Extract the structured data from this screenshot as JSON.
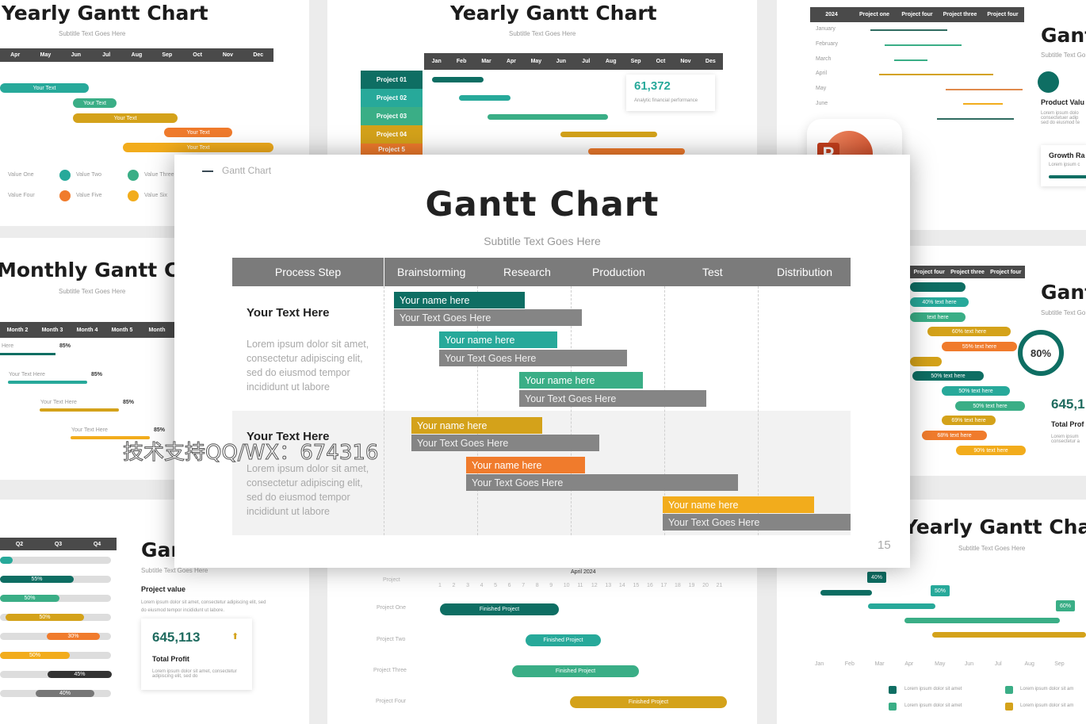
{
  "bg_top_left": {
    "title": "Yearly Gantt Chart",
    "subtitle": "Subtitle Text Goes Here",
    "months": [
      "Apr",
      "May",
      "Jun",
      "Jul",
      "Aug",
      "Sep",
      "Oct",
      "Nov",
      "Dec"
    ],
    "bars": [
      "Your Text",
      "Your Text",
      "Your Text",
      "Your Text",
      "Your Text"
    ],
    "legend": [
      "Value One",
      "Value Two",
      "Value Three",
      "Value Four",
      "Value Five",
      "Value Six"
    ]
  },
  "bg_top_center": {
    "title": "Yearly Gantt Chart",
    "subtitle": "Subtitle Text Goes Here",
    "months": [
      "Jan",
      "Feb",
      "Mar",
      "Apr",
      "May",
      "Jun",
      "Jul",
      "Aug",
      "Sep",
      "Oct",
      "Nov",
      "Des"
    ],
    "projects": [
      "Project 01",
      "Project 02",
      "Project 03",
      "Project 04",
      "Project 5"
    ],
    "stat_value": "61,372",
    "stat_label": "Analytic financial performance"
  },
  "bg_top_right": {
    "headers": [
      "2024",
      "Project one",
      "Project four",
      "Project three",
      "Project four"
    ],
    "months": [
      "January",
      "February",
      "March",
      "April",
      "May",
      "June"
    ],
    "title": "Gant",
    "subtitle": "Subtitle Text Go",
    "product_value": "Product Valu",
    "product_text": "Lorem ipsum dolo consectetuer adip sed do eiusmod te",
    "growth": "Growth Ra",
    "growth_text": "Lorem ipsum c"
  },
  "bg_mid_left": {
    "title": "Monthly Gantt Cha",
    "subtitle": "Subtitle Text Goes Here",
    "months": [
      "Month 2",
      "Month 3",
      "Month 4",
      "Month 5",
      "Month"
    ],
    "rows": [
      {
        "label": "Here",
        "pct": "85%"
      },
      {
        "label": "Your Text Here",
        "pct": "85%"
      },
      {
        "label": "Your Text Here",
        "pct": "85%"
      },
      {
        "label": "Your Text Here",
        "pct": "85%"
      }
    ]
  },
  "bg_mid_right": {
    "headers": [
      "Project four",
      "Project three",
      "Project four"
    ],
    "bars": [
      "40%  text here",
      "text here",
      "60%  text here",
      "55%  text here",
      "50%  text here",
      "50%  text here",
      "50%  text here",
      "69%  text here",
      "68%  text here",
      "90%  text here"
    ],
    "title": "Gant",
    "subtitle": "Subtitle Text Go",
    "ring_value": "80%",
    "ring_fraction": 0.8,
    "stat": "645,1",
    "stat_label": "Total Prof",
    "stat_text": "Lorem ipsum consectetur a"
  },
  "bg_bottom_left": {
    "quarters": [
      "Q2",
      "Q3",
      "Q4"
    ],
    "bars": [
      "",
      "55%",
      "50%",
      "50%",
      "30%",
      "50%",
      "45%",
      "40%"
    ],
    "title": "Gar",
    "subtitle": "Subtitle Text Goes Here",
    "section": "Project value",
    "section_text": "Lorem ipsum dolor sit amet, consectetur adipiscing elit, sed do eiusmod tempor incididunt ut labore.",
    "stat": "645,113",
    "stat_label": "Total Profit",
    "stat_text": "Lorem ipsum dolor sit amet, consectetur adipiscing elit, sed do"
  },
  "bg_bottom_center": {
    "month": "April 2024",
    "project_header": "Project",
    "days": [
      "1",
      "2",
      "3",
      "4",
      "5",
      "6",
      "7",
      "8",
      "9",
      "10",
      "11",
      "12",
      "13",
      "14",
      "15",
      "16",
      "17",
      "18",
      "19",
      "20",
      "21"
    ],
    "projects": [
      "Project One",
      "Project Two",
      "Project Three",
      "Project Four"
    ],
    "bar_label": "Finished Project"
  },
  "bg_bottom_right": {
    "title": "Yearly Gantt Chart",
    "subtitle": "Subtitle Text Goes Here",
    "callouts": [
      "40%",
      "50%",
      "60%"
    ],
    "months": [
      "Jan",
      "Feb",
      "Mar",
      "Apr",
      "May",
      "Jun",
      "Jul",
      "Aug",
      "Sep"
    ],
    "legend": [
      "Lorem ipsum dolor sit amet",
      "Lorem ipsum dolor sit amet",
      "Lorem ipsum dolor sit am",
      "Lorem ipsum dolor sit am"
    ]
  },
  "app_icon": "powerpoint-icon",
  "watermark": "技术支持QQ/WX：674316",
  "slide": {
    "breadcrumb": "Gantt Chart",
    "title": "Gantt Chart",
    "subtitle": "Subtitle Text Goes Here",
    "page_number": "15",
    "columns": [
      "Process Step",
      "Brainstorming",
      "Research",
      "Production",
      "Test",
      "Distribution"
    ],
    "groups": [
      {
        "heading": "Your Text Here",
        "body": "Lorem ipsum dolor sit amet, consectetur adipiscing elit, sed do eiusmod tempor incididunt ut labore"
      },
      {
        "heading": "Your Text Here",
        "body": "Lorem ipsum dolor sit amet, consectetur adipiscing elit, sed do eiusmod tempor incididunt ut labore"
      }
    ],
    "tasks": [
      {
        "name": "Your name here",
        "text": "Your Text Goes Here",
        "color": "#0e6e63"
      },
      {
        "name": "Your name here",
        "text": "Your Text Goes Here",
        "color": "#27a99a"
      },
      {
        "name": "Your name here",
        "text": "Your Text Goes Here",
        "color": "#3aae86"
      },
      {
        "name": "Your name here",
        "text": "Your Text Goes Here",
        "color": "#d4a21a"
      },
      {
        "name": "Your name here",
        "text": "Your Text Goes Here",
        "color": "#f07b2c"
      },
      {
        "name": "Your name here",
        "text": "Your Text Goes Here",
        "color": "#f2ac1c"
      }
    ]
  }
}
